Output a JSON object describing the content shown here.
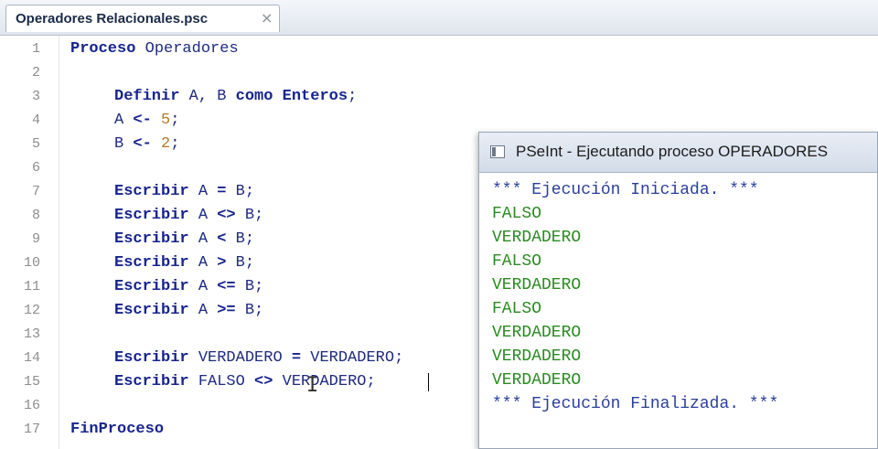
{
  "tab": {
    "label": "Operadores Relacionales.psc",
    "close_glyph": "×"
  },
  "editor": {
    "lines": [
      {
        "n": "1",
        "parts": [
          [
            "kw",
            "Proceso"
          ],
          [
            "id",
            " Operadores"
          ]
        ]
      },
      {
        "n": "2",
        "parts": []
      },
      {
        "n": "3",
        "parts": [
          [
            "kw",
            "Definir"
          ],
          [
            "id",
            " A, B "
          ],
          [
            "kw",
            "como Enteros"
          ],
          [
            "id",
            ";"
          ]
        ]
      },
      {
        "n": "4",
        "parts": [
          [
            "id",
            "A "
          ],
          [
            "op",
            "<-"
          ],
          [
            "id",
            " "
          ],
          [
            "num",
            "5"
          ],
          [
            "id",
            ";"
          ]
        ]
      },
      {
        "n": "5",
        "parts": [
          [
            "id",
            "B "
          ],
          [
            "op",
            "<-"
          ],
          [
            "id",
            " "
          ],
          [
            "num",
            "2"
          ],
          [
            "id",
            ";"
          ]
        ]
      },
      {
        "n": "6",
        "parts": []
      },
      {
        "n": "7",
        "parts": [
          [
            "kw",
            "Escribir"
          ],
          [
            "id",
            " A "
          ],
          [
            "op",
            "="
          ],
          [
            "id",
            " B;"
          ]
        ]
      },
      {
        "n": "8",
        "parts": [
          [
            "kw",
            "Escribir"
          ],
          [
            "id",
            " A "
          ],
          [
            "op",
            "<>"
          ],
          [
            "id",
            " B;"
          ]
        ]
      },
      {
        "n": "9",
        "parts": [
          [
            "kw",
            "Escribir"
          ],
          [
            "id",
            " A "
          ],
          [
            "op",
            "<"
          ],
          [
            "id",
            " B;"
          ]
        ]
      },
      {
        "n": "10",
        "parts": [
          [
            "kw",
            "Escribir"
          ],
          [
            "id",
            " A "
          ],
          [
            "op",
            ">"
          ],
          [
            "id",
            " B;"
          ]
        ]
      },
      {
        "n": "11",
        "parts": [
          [
            "kw",
            "Escribir"
          ],
          [
            "id",
            " A "
          ],
          [
            "op",
            "<="
          ],
          [
            "id",
            " B;"
          ]
        ]
      },
      {
        "n": "12",
        "parts": [
          [
            "kw",
            "Escribir"
          ],
          [
            "id",
            " A "
          ],
          [
            "op",
            ">="
          ],
          [
            "id",
            " B;"
          ]
        ]
      },
      {
        "n": "13",
        "parts": []
      },
      {
        "n": "14",
        "parts": [
          [
            "kw",
            "Escribir"
          ],
          [
            "id",
            " VERDADERO "
          ],
          [
            "op",
            "="
          ],
          [
            "id",
            " VERDADERO;"
          ]
        ]
      },
      {
        "n": "15",
        "parts": [
          [
            "kw",
            "Escribir"
          ],
          [
            "id",
            " FALSO "
          ],
          [
            "op",
            "<>"
          ],
          [
            "id",
            " VERDADERO;"
          ]
        ]
      },
      {
        "n": "16",
        "parts": []
      },
      {
        "n": "17",
        "parts": [
          [
            "kw",
            "FinProceso"
          ]
        ]
      }
    ]
  },
  "run_window": {
    "title": "PSeInt - Ejecutando proceso OPERADORES",
    "output": [
      {
        "text": "*** Ejecución Iniciada. ***",
        "style": "blue"
      },
      {
        "text": "FALSO",
        "style": "green"
      },
      {
        "text": "VERDADERO",
        "style": "green"
      },
      {
        "text": "FALSO",
        "style": "green"
      },
      {
        "text": "VERDADERO",
        "style": "green"
      },
      {
        "text": "FALSO",
        "style": "green"
      },
      {
        "text": "VERDADERO",
        "style": "green"
      },
      {
        "text": "VERDADERO",
        "style": "green"
      },
      {
        "text": "VERDADERO",
        "style": "green"
      },
      {
        "text": "*** Ejecución Finalizada. ***",
        "style": "blue"
      }
    ]
  },
  "colors": {
    "keyword": "#17248f",
    "number": "#b77a27",
    "output_value": "#2b8a22",
    "output_banner": "#2a3f9b"
  }
}
